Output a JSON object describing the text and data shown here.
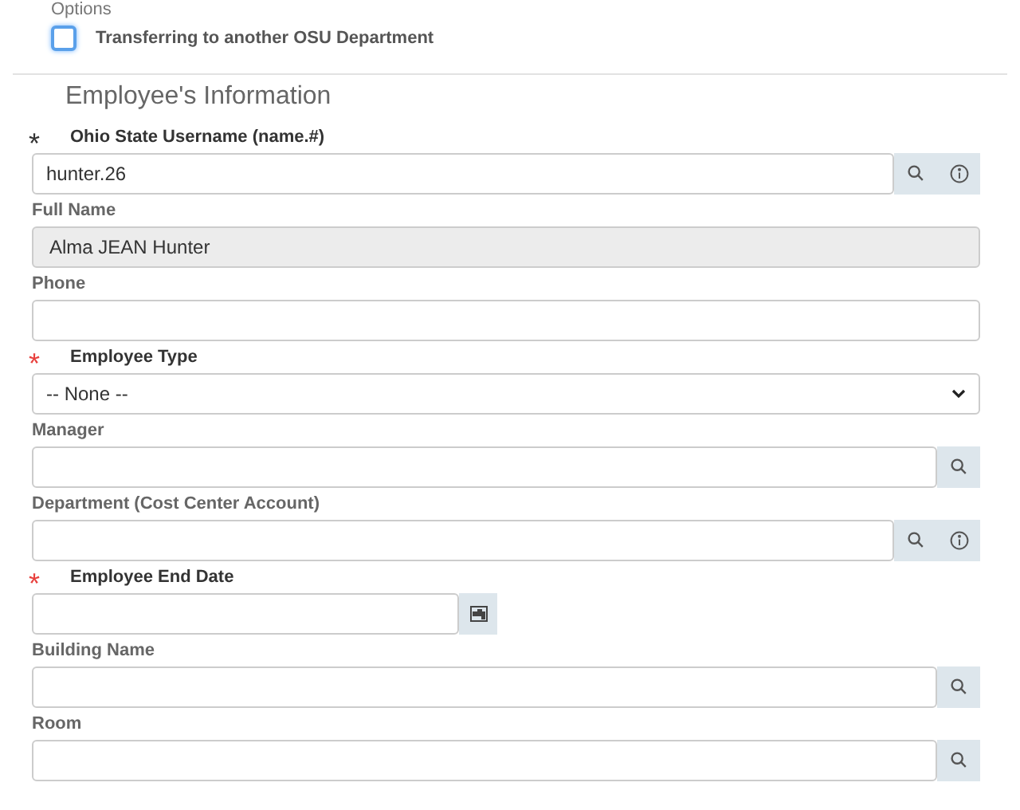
{
  "options": {
    "title": "Options",
    "checkbox": {
      "label": "Transferring to another OSU Department",
      "checked": false
    }
  },
  "section_title": "Employee's Information",
  "fields": [
    {
      "kind": "lookup",
      "label": "Ohio State Username (name.#)",
      "required_mark": "*",
      "required_met": true,
      "value": "hunter.26",
      "info": true
    },
    {
      "kind": "readonly",
      "label": "Full Name",
      "value": "Alma JEAN Hunter"
    },
    {
      "kind": "text",
      "label": "Phone"
    },
    {
      "kind": "select",
      "label": "Employee Type",
      "required_mark": "*",
      "required_met": false,
      "value": "-- None --"
    },
    {
      "kind": "lookup",
      "label": "Manager"
    },
    {
      "kind": "lookup",
      "label": "Department (Cost Center Account)",
      "info": true
    },
    {
      "kind": "date",
      "label": "Employee End Date",
      "required_mark": "*",
      "required_met": false
    },
    {
      "kind": "lookup",
      "label": "Building Name"
    },
    {
      "kind": "lookup",
      "label": "Room"
    }
  ]
}
